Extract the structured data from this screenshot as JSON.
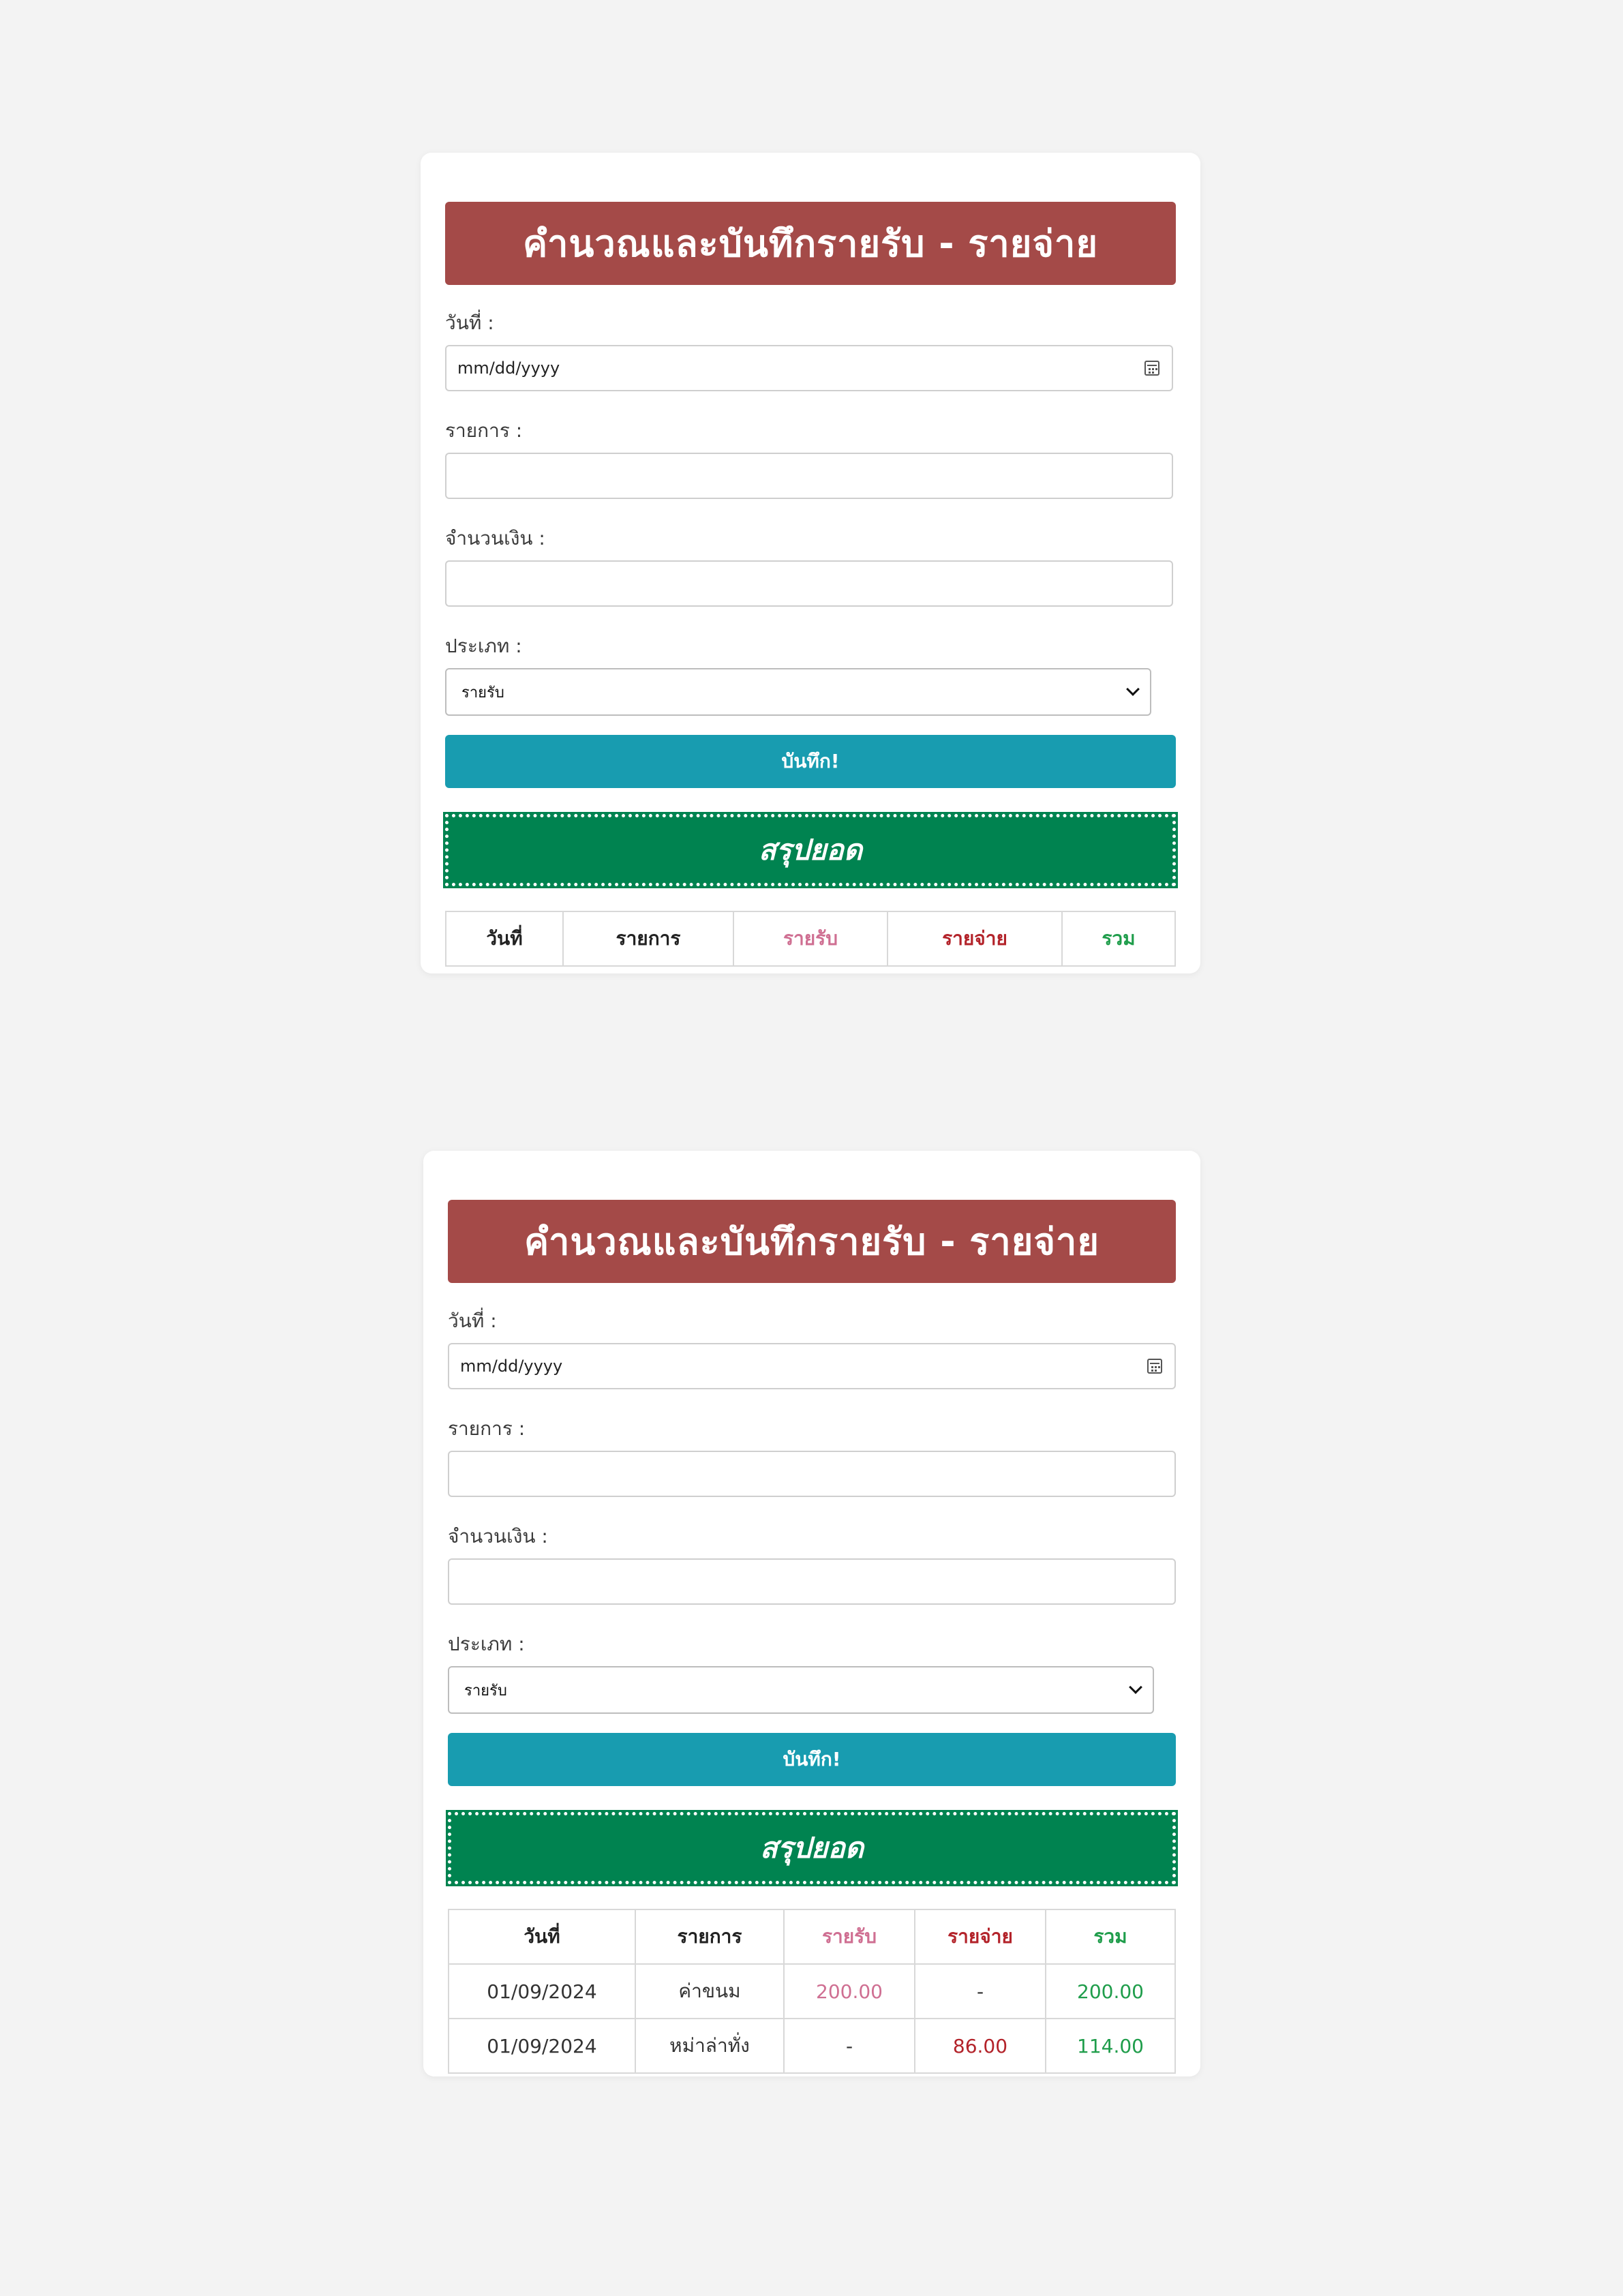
{
  "colors": {
    "title_bg": "#a44a48",
    "button_bg": "#189cb0",
    "summary_bg": "#008350",
    "income": "#cf6f92",
    "expense": "#b3232a",
    "total": "#1f9d4b",
    "text_dark": "#222222"
  },
  "form": {
    "title": "คำนวณและบันทึกรายรับ - รายจ่าย",
    "date_label": "วันที่ :",
    "date_placeholder": "mm/dd/yyyy",
    "item_label": "รายการ :",
    "item_value": "",
    "amount_label": "จำนวนเงิน :",
    "amount_value": "",
    "type_label": "ประเภท :",
    "type_selected": "รายรับ",
    "save_label": "บันทึก!",
    "summary_label": "สรุปยอด"
  },
  "table": {
    "headers": [
      "วันที่",
      "รายการ",
      "รายรับ",
      "รายจ่าย",
      "รวม"
    ]
  },
  "entries": [
    {
      "date": "01/09/2024",
      "item": "ค่าขนม",
      "income": "200.00",
      "expense": "-",
      "total": "200.00"
    },
    {
      "date": "01/09/2024",
      "item": "หม่าล่าทั่ง",
      "income": "-",
      "expense": "86.00",
      "total": "114.00"
    }
  ]
}
